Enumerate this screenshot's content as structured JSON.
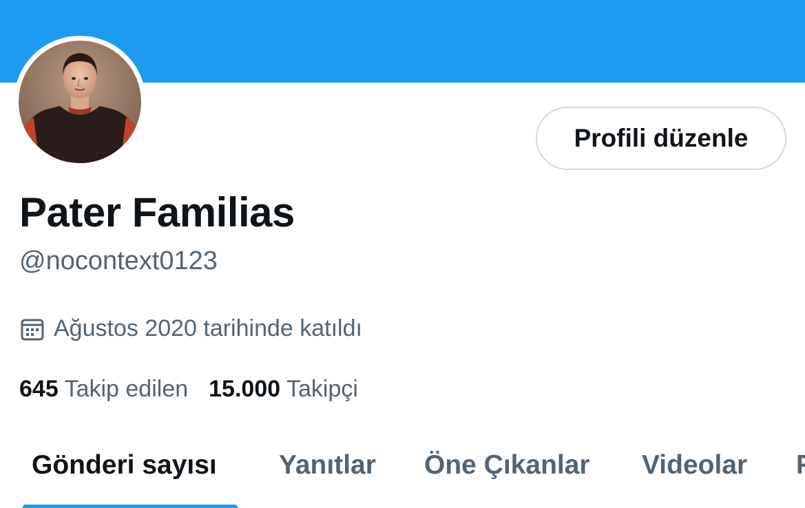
{
  "profile": {
    "edit_button_label": "Profili düzenle",
    "display_name": "Pater Familias",
    "handle": "@nocontext0123",
    "joined_text": "Ağustos 2020 tarihinde katıldı",
    "following_count": "645",
    "following_label": "Takip edilen",
    "followers_count": "15.000",
    "followers_label": "Takipçi"
  },
  "tabs": [
    {
      "label": "Gönderi sayısı",
      "active": true
    },
    {
      "label": "Yanıtlar",
      "active": false
    },
    {
      "label": "Öne Çıkanlar",
      "active": false
    },
    {
      "label": "Videolar",
      "active": false
    },
    {
      "label": "F",
      "active": false
    }
  ],
  "colors": {
    "accent": "#1d9bf0",
    "text_primary": "#0f1419",
    "text_secondary": "#536471",
    "border": "#cfd9de"
  },
  "icons": {
    "joined": "calendar-icon"
  }
}
